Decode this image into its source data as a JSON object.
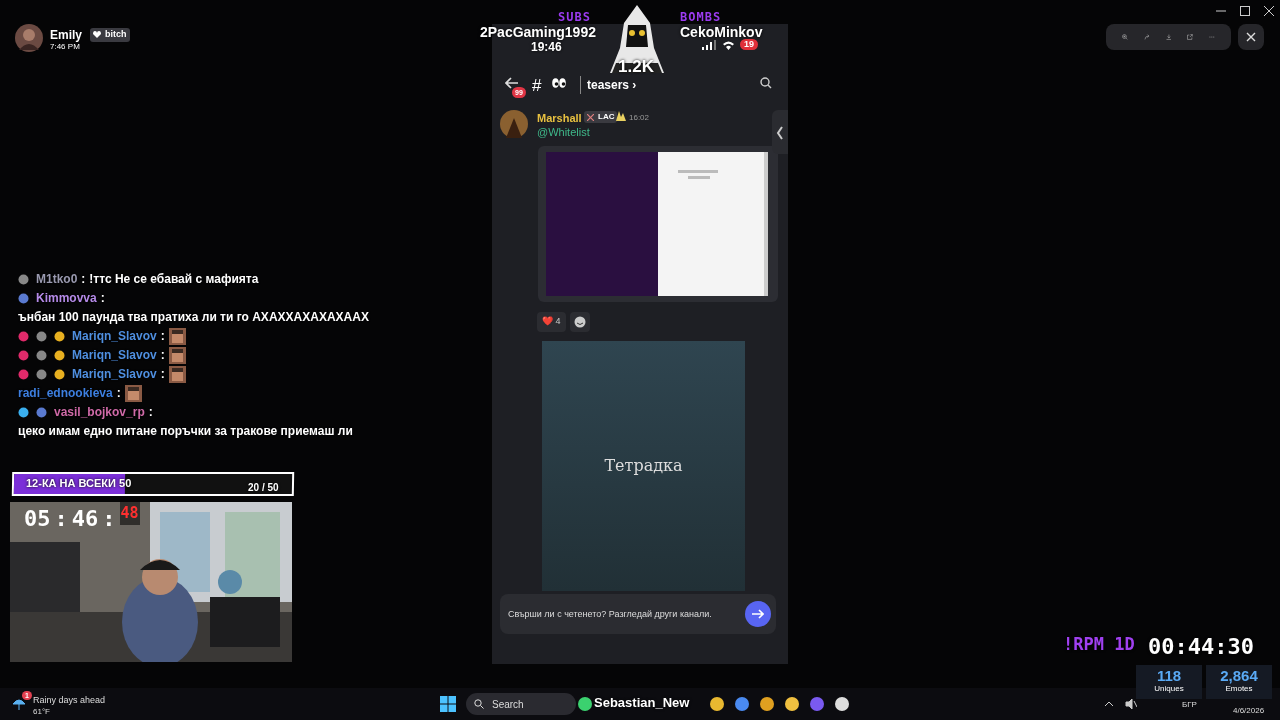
{
  "profile": {
    "name": "Emily",
    "badge": "bitch",
    "time": "7:46 PM"
  },
  "chat": [
    {
      "user": "M1tko0",
      "color": "#9a9ab0",
      "badges": [
        {
          "kind": "mod"
        }
      ],
      "separator": ":",
      "text": "!ттс Не се ебавай с мафията"
    },
    {
      "user": "Kimmovva",
      "color": "#b58ae8",
      "badges": [
        {
          "kind": "mic"
        }
      ],
      "separator": ":",
      "text": "ънбан 100 паунда тва пратиха ли ти го АХАХХАХАХАХААХ"
    },
    {
      "user": "Mariqn_Slavov",
      "color": "#4f8fe0",
      "badges": [
        {
          "kind": "gem"
        },
        {
          "kind": "mod"
        },
        {
          "kind": "crown"
        }
      ],
      "separator": ":",
      "emote": true
    },
    {
      "user": "Mariqn_Slavov",
      "color": "#4f8fe0",
      "badges": [
        {
          "kind": "gem"
        },
        {
          "kind": "mod"
        },
        {
          "kind": "crown"
        }
      ],
      "separator": ":",
      "emote": true
    },
    {
      "user": "Mariqn_Slavov",
      "color": "#4f8fe0",
      "badges": [
        {
          "kind": "gem"
        },
        {
          "kind": "mod"
        },
        {
          "kind": "crown"
        }
      ],
      "separator": ":",
      "emote": true
    },
    {
      "user": "radi_ednookieva",
      "color": "#3d7fe0",
      "separator": ":",
      "emote": true
    },
    {
      "user": "vasil_bojkov_rp",
      "color": "#d06aa8",
      "badges": [
        {
          "kind": "ice"
        },
        {
          "kind": "mic"
        }
      ],
      "separator": ":",
      "text": "цеко имам едно питане поръчки за тракове приемаш ли"
    }
  ],
  "goal": {
    "label": "12-КА НА ВСЕКИ 50",
    "count": "20 / 50",
    "level": 0.4
  },
  "timer": [
    {
      "text": "05",
      "kind": "digits"
    },
    {
      "text": ":",
      "kind": "sep"
    },
    {
      "text": "46",
      "kind": "digits"
    },
    {
      "text": ":",
      "kind": "sep"
    },
    {
      "text": "48",
      "kind": "seconds"
    }
  ],
  "stream": {
    "subs_label": "SUBS",
    "subs_user": "2PacGaming1992",
    "bombs_label": "BOMBS",
    "bombs_user": "CekoMinkov",
    "viewers": "1.2K"
  },
  "phone": {
    "clock": "19:46",
    "battery": "19",
    "channel": {
      "unread": "99",
      "hash": "#",
      "name": "teasers",
      "chevron": "›"
    },
    "message": {
      "author": "Marshall",
      "tag": "LAC",
      "time": "16:02",
      "mention": "@Whitelist"
    },
    "reactions": [
      {
        "emoji": "❤️",
        "count": "4"
      }
    ],
    "cover_title": "Тетрадка",
    "composer": {
      "placeholder": "Свърши ли с четенето? Разгледай други канали."
    }
  },
  "counter": {
    "label": "!RPM 1D",
    "time": "00:44:30"
  },
  "stats": [
    {
      "value": "118",
      "label": "Uniques"
    },
    {
      "value": "2,864",
      "label": "Emotes"
    }
  ],
  "taskbar": {
    "weather_title": "Rainy days ahead",
    "weather_temp": "61°F",
    "weather_alerts": "1",
    "search": "Search",
    "overlay_name": "Sebastian_New",
    "language": "БГР",
    "date": "4/6/2026"
  }
}
